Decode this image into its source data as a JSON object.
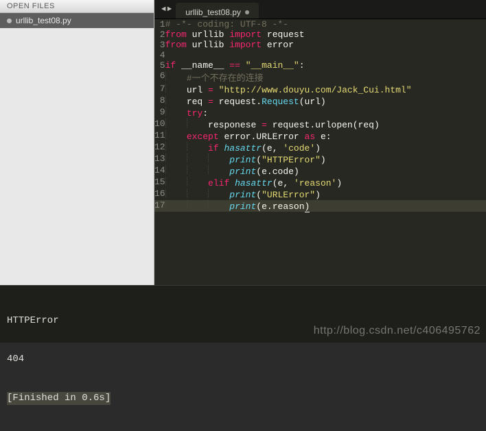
{
  "sidebar": {
    "header": "OPEN FILES",
    "items": [
      {
        "label": "urllib_test08.py"
      }
    ]
  },
  "tabs": {
    "active": {
      "label": "urllib_test08.py"
    },
    "nav_prev": "◄",
    "nav_next": "►"
  },
  "editor": {
    "lines": [
      {
        "n": 1,
        "tokens": [
          [
            "c-comment",
            "# -*- coding: UTF-8 -*-"
          ]
        ]
      },
      {
        "n": 2,
        "tokens": [
          [
            "c-keyword",
            "from"
          ],
          [
            "sp",
            " "
          ],
          [
            "c-ident",
            "urllib"
          ],
          [
            "sp",
            " "
          ],
          [
            "c-keyword",
            "import"
          ],
          [
            "sp",
            " "
          ],
          [
            "c-ident",
            "request"
          ]
        ]
      },
      {
        "n": 3,
        "tokens": [
          [
            "c-keyword",
            "from"
          ],
          [
            "sp",
            " "
          ],
          [
            "c-ident",
            "urllib"
          ],
          [
            "sp",
            " "
          ],
          [
            "c-keyword",
            "import"
          ],
          [
            "sp",
            " "
          ],
          [
            "c-ident",
            "error"
          ]
        ]
      },
      {
        "n": 4,
        "tokens": []
      },
      {
        "n": 5,
        "tokens": [
          [
            "c-keyword",
            "if"
          ],
          [
            "sp",
            " "
          ],
          [
            "c-ident",
            "__name__"
          ],
          [
            "sp",
            " "
          ],
          [
            "c-keyword",
            "=="
          ],
          [
            "sp",
            " "
          ],
          [
            "c-string",
            "\"__main__\""
          ],
          [
            "c-punc",
            ":"
          ]
        ]
      },
      {
        "n": 6,
        "tokens": [
          [
            "indent",
            "    "
          ],
          [
            "c-comment",
            "#一个不存在的连接"
          ]
        ]
      },
      {
        "n": 7,
        "tokens": [
          [
            "indent",
            "    "
          ],
          [
            "c-ident",
            "url"
          ],
          [
            "sp",
            " "
          ],
          [
            "c-keyword",
            "="
          ],
          [
            "sp",
            " "
          ],
          [
            "c-string",
            "\"http://www.douyu.com/Jack_Cui.html\""
          ]
        ]
      },
      {
        "n": 8,
        "tokens": [
          [
            "indent",
            "    "
          ],
          [
            "c-ident",
            "req"
          ],
          [
            "sp",
            " "
          ],
          [
            "c-keyword",
            "="
          ],
          [
            "sp",
            " "
          ],
          [
            "c-ident",
            "request"
          ],
          [
            "c-punc",
            "."
          ],
          [
            "c-builtin-ni",
            "Request"
          ],
          [
            "c-paren",
            "("
          ],
          [
            "c-ident",
            "url"
          ],
          [
            "c-paren",
            ")"
          ]
        ]
      },
      {
        "n": 9,
        "tokens": [
          [
            "indent",
            "    "
          ],
          [
            "c-keyword",
            "try"
          ],
          [
            "c-punc",
            ":"
          ]
        ]
      },
      {
        "n": 10,
        "tokens": [
          [
            "indent",
            "        "
          ],
          [
            "c-ident",
            "responese"
          ],
          [
            "sp",
            " "
          ],
          [
            "c-keyword",
            "="
          ],
          [
            "sp",
            " "
          ],
          [
            "c-ident",
            "request"
          ],
          [
            "c-punc",
            "."
          ],
          [
            "c-ident",
            "urlopen"
          ],
          [
            "c-paren",
            "("
          ],
          [
            "c-ident",
            "req"
          ],
          [
            "c-paren",
            ")"
          ]
        ]
      },
      {
        "n": 11,
        "tokens": [
          [
            "indent",
            "    "
          ],
          [
            "c-keyword",
            "except"
          ],
          [
            "sp",
            " "
          ],
          [
            "c-ident",
            "error"
          ],
          [
            "c-punc",
            "."
          ],
          [
            "c-ident",
            "URLError"
          ],
          [
            "sp",
            " "
          ],
          [
            "c-keyword",
            "as"
          ],
          [
            "sp",
            " "
          ],
          [
            "c-ident",
            "e"
          ],
          [
            "c-punc",
            ":"
          ]
        ]
      },
      {
        "n": 12,
        "tokens": [
          [
            "indent",
            "        "
          ],
          [
            "c-keyword",
            "if"
          ],
          [
            "sp",
            " "
          ],
          [
            "c-builtin",
            "hasattr"
          ],
          [
            "c-paren",
            "("
          ],
          [
            "c-ident",
            "e"
          ],
          [
            "c-punc",
            ","
          ],
          [
            "sp",
            " "
          ],
          [
            "c-string",
            "'code'"
          ],
          [
            "c-paren",
            ")"
          ]
        ]
      },
      {
        "n": 13,
        "tokens": [
          [
            "indent",
            "            "
          ],
          [
            "c-builtin",
            "print"
          ],
          [
            "c-paren",
            "("
          ],
          [
            "c-string",
            "\"HTTPError\""
          ],
          [
            "c-paren",
            ")"
          ]
        ]
      },
      {
        "n": 14,
        "tokens": [
          [
            "indent",
            "            "
          ],
          [
            "c-builtin",
            "print"
          ],
          [
            "c-paren",
            "("
          ],
          [
            "c-ident",
            "e"
          ],
          [
            "c-punc",
            "."
          ],
          [
            "c-ident",
            "code"
          ],
          [
            "c-paren",
            ")"
          ]
        ]
      },
      {
        "n": 15,
        "tokens": [
          [
            "indent",
            "        "
          ],
          [
            "c-keyword",
            "elif"
          ],
          [
            "sp",
            " "
          ],
          [
            "c-builtin",
            "hasattr"
          ],
          [
            "c-paren",
            "("
          ],
          [
            "c-ident",
            "e"
          ],
          [
            "c-punc",
            ","
          ],
          [
            "sp",
            " "
          ],
          [
            "c-string",
            "'reason'"
          ],
          [
            "c-paren",
            ")"
          ]
        ]
      },
      {
        "n": 16,
        "tokens": [
          [
            "indent",
            "            "
          ],
          [
            "c-builtin",
            "print"
          ],
          [
            "c-paren",
            "("
          ],
          [
            "c-string",
            "\"URLError\""
          ],
          [
            "c-paren",
            ")"
          ]
        ]
      },
      {
        "n": 17,
        "tokens": [
          [
            "indent",
            "            "
          ],
          [
            "c-builtin",
            "print"
          ],
          [
            "c-paren",
            "("
          ],
          [
            "c-ident",
            "e"
          ],
          [
            "c-punc",
            "."
          ],
          [
            "c-ident",
            "reason"
          ],
          [
            "c-paren-cursor",
            ")"
          ]
        ],
        "current": true
      }
    ]
  },
  "console": {
    "lines": [
      "HTTPError",
      "404",
      "[Finished in 0.6s]"
    ]
  },
  "watermark": "http://blog.csdn.net/c406495762"
}
